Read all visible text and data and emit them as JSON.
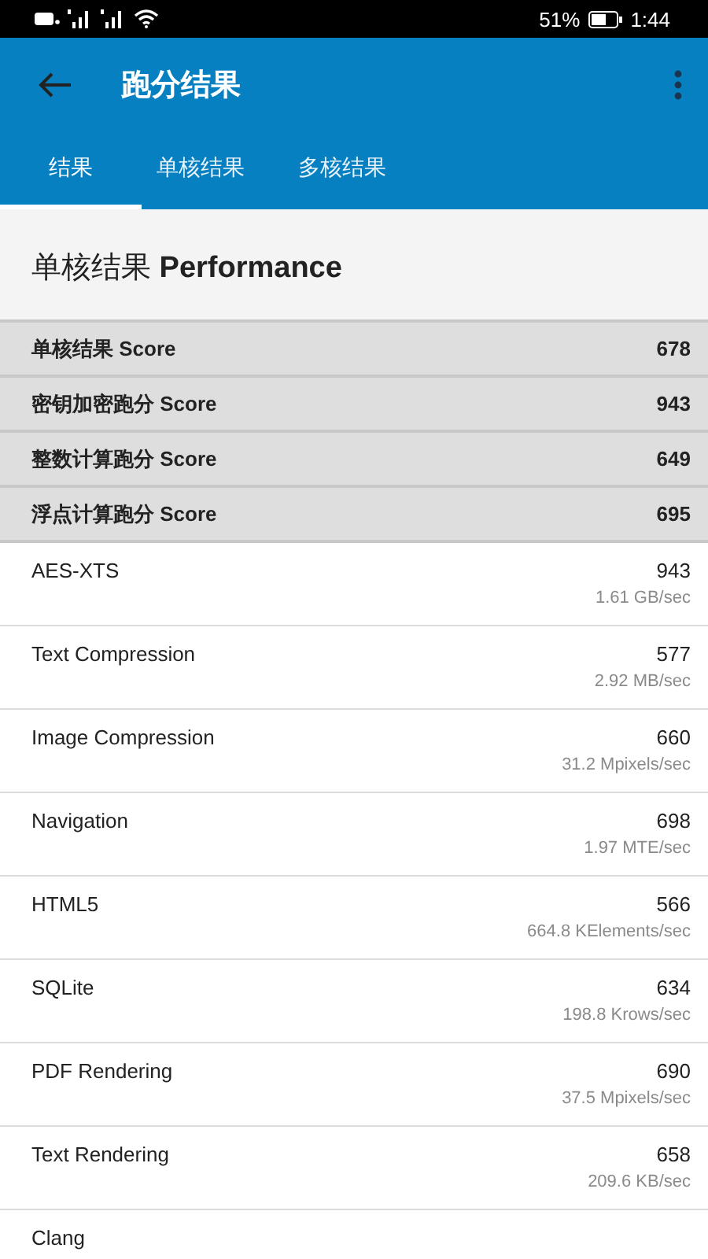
{
  "status_bar": {
    "battery_text": "51%",
    "time": "1:44"
  },
  "app_bar": {
    "title": "跑分结果"
  },
  "tabs": [
    {
      "label": "结果",
      "selected": true
    },
    {
      "label": "单核结果",
      "selected": false
    },
    {
      "label": "多核结果",
      "selected": false
    }
  ],
  "section": {
    "title": "单核结果 **Performance**"
  },
  "score_rows": [
    {
      "name": "单核结果 Score",
      "value": "678"
    },
    {
      "name": "密钥加密跑分 Score",
      "value": "943"
    },
    {
      "name": "整数计算跑分 Score",
      "value": "649"
    },
    {
      "name": "浮点计算跑分 Score",
      "value": "695"
    }
  ],
  "test_rows": [
    {
      "name": "AES-XTS",
      "value": "943",
      "rate": "1.61 GB/sec"
    },
    {
      "name": "Text Compression",
      "value": "577",
      "rate": "2.92 MB/sec"
    },
    {
      "name": "Image Compression",
      "value": "660",
      "rate": "31.2 Mpixels/sec"
    },
    {
      "name": "Navigation",
      "value": "698",
      "rate": "1.97 MTE/sec"
    },
    {
      "name": "HTML5",
      "value": "566",
      "rate": "664.8 KElements/sec"
    },
    {
      "name": "SQLite",
      "value": "634",
      "rate": "198.8 Krows/sec"
    },
    {
      "name": "PDF Rendering",
      "value": "690",
      "rate": "37.5 Mpixels/sec"
    },
    {
      "name": "Text Rendering",
      "value": "658",
      "rate": "209.6 KB/sec"
    },
    {
      "name": "Clang"
    }
  ]
}
